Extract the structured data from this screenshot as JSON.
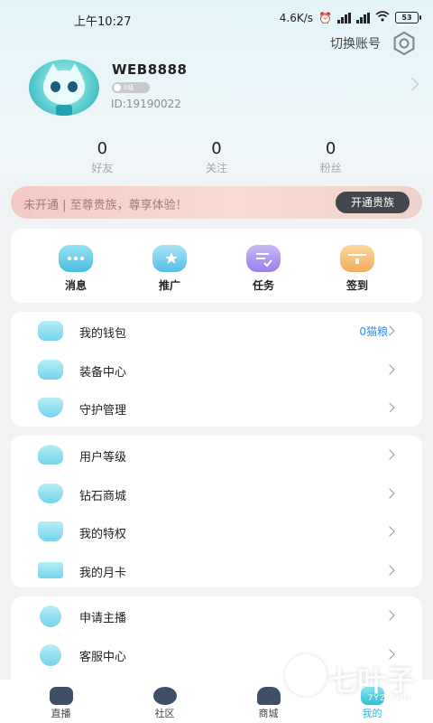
{
  "status_bar": {
    "time": "上午10:27",
    "speed": "4.6K/s",
    "battery": "53"
  },
  "header": {
    "switch_account": "切换账号",
    "settings_icon": "gear-icon"
  },
  "profile": {
    "username": "WEB8888",
    "level_badge": "0级",
    "user_id": "ID:19190022"
  },
  "stats": [
    {
      "value": "0",
      "label": "好友"
    },
    {
      "value": "0",
      "label": "关注"
    },
    {
      "value": "0",
      "label": "粉丝"
    }
  ],
  "vip_banner": {
    "text": "未开通 | 至尊贵族，尊享体验！",
    "button": "开通贵族"
  },
  "quick_actions": [
    {
      "label": "消息",
      "icon": "chat-icon",
      "color": "#58c6e6"
    },
    {
      "label": "推广",
      "icon": "megaphone-icon",
      "color": "#5fc3e8"
    },
    {
      "label": "任务",
      "icon": "task-icon",
      "color": "#a98ef0"
    },
    {
      "label": "签到",
      "icon": "calendar-icon",
      "color": "#f4b96c"
    }
  ],
  "menu_group_1": [
    {
      "label": "我的钱包",
      "value": "0猫粮",
      "icon": "wallet-icon"
    },
    {
      "label": "装备中心",
      "value": "",
      "icon": "equipment-icon"
    },
    {
      "label": "守护管理",
      "value": "",
      "icon": "shield-icon"
    }
  ],
  "menu_group_2": [
    {
      "label": "用户等级",
      "icon": "star-icon"
    },
    {
      "label": "钻石商城",
      "icon": "diamond-icon"
    },
    {
      "label": "我的特权",
      "icon": "crown-icon"
    },
    {
      "label": "我的月卡",
      "icon": "card-icon"
    }
  ],
  "menu_group_3": [
    {
      "label": "申请主播",
      "icon": "microphone-icon"
    },
    {
      "label": "客服中心",
      "icon": "support-icon"
    }
  ],
  "tab_bar": [
    {
      "label": "直播",
      "icon": "live-icon"
    },
    {
      "label": "社区",
      "icon": "community-icon"
    },
    {
      "label": "商城",
      "icon": "shop-icon"
    },
    {
      "label": "我的",
      "icon": "profile-icon"
    }
  ],
  "watermark": {
    "brand": "七叶子",
    "url": "7YZ.COM"
  }
}
